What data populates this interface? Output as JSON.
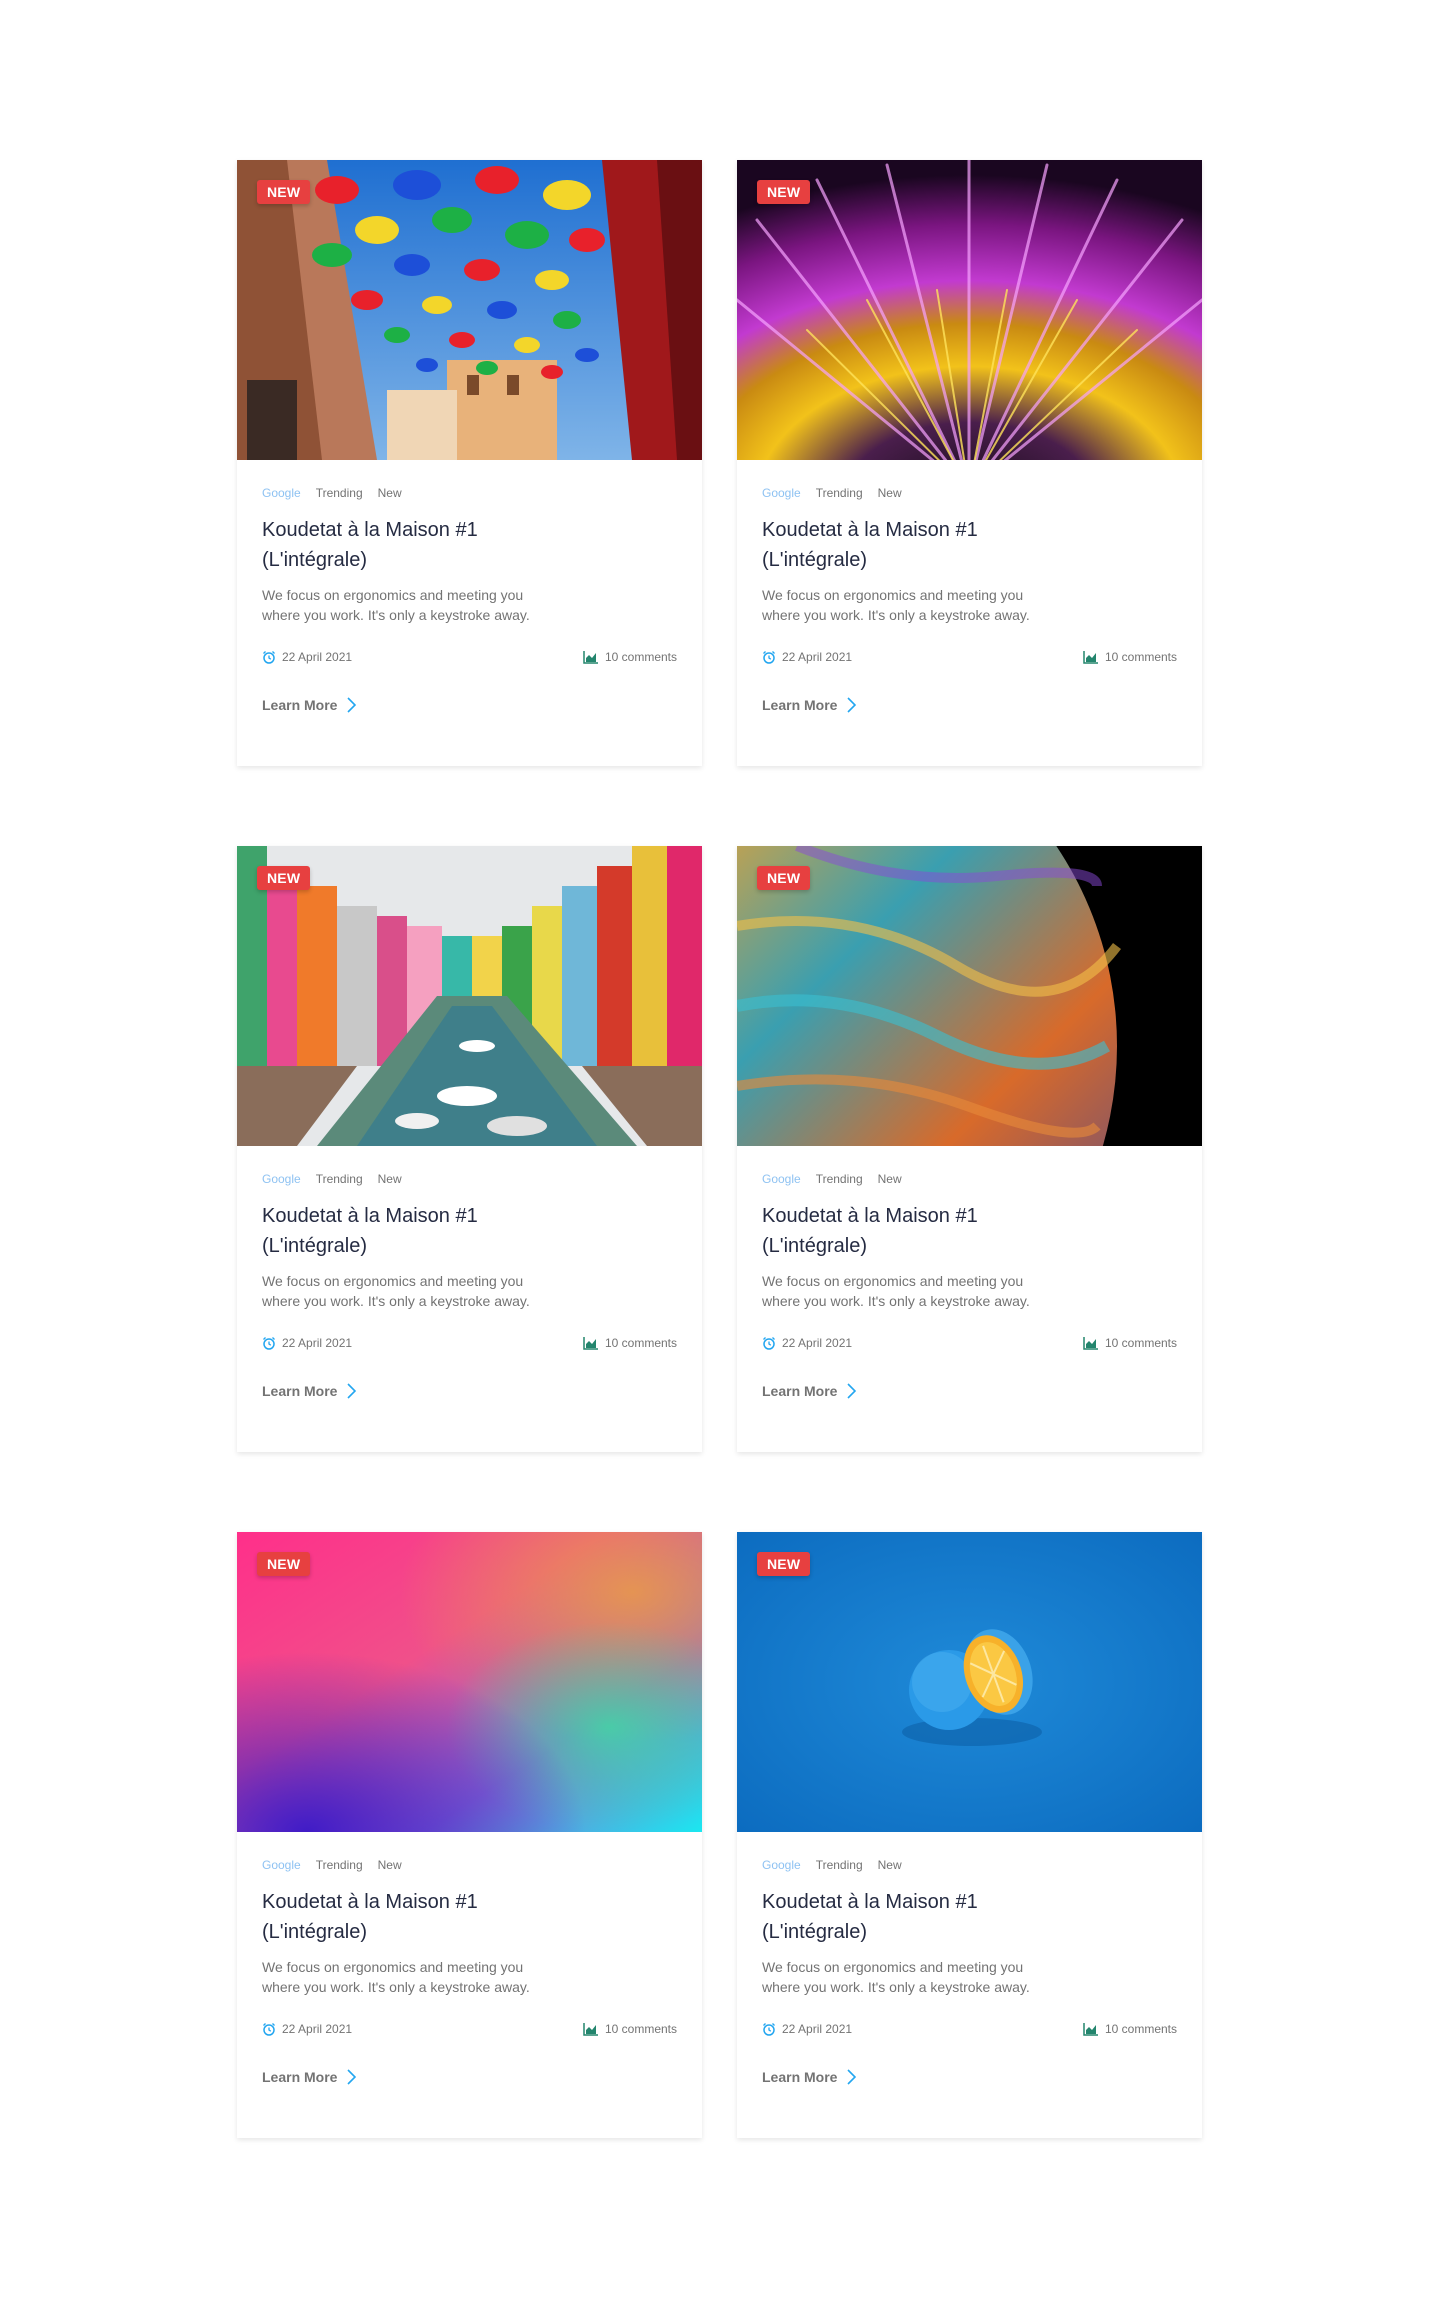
{
  "colors": {
    "badge": "#e74040",
    "tag_primary": "#8ec2f2",
    "muted": "#737373",
    "heading": "#252b42",
    "accent_blue": "#23a6f0",
    "accent_green": "#23856d"
  },
  "cards": [
    {
      "image": "colorful-umbrellas-street",
      "badge": "NEW",
      "tags": [
        "Google",
        "Trending",
        "New"
      ],
      "title": "Koudetat à la Maison #1 (L'intégrale)",
      "description": "We focus on ergonomics and meeting you where you work. It's only a keystroke away.",
      "date": "22 April 2021",
      "comments": "10 comments",
      "cta": "Learn More",
      "icons": [
        "alarm-clock-icon",
        "chart-icon",
        "chevron-right-icon"
      ]
    },
    {
      "image": "purple-gold-light-burst",
      "badge": "NEW",
      "tags": [
        "Google",
        "Trending",
        "New"
      ],
      "title": "Koudetat à la Maison #1 (L'intégrale)",
      "description": "We focus on ergonomics and meeting you where you work. It's only a keystroke away.",
      "date": "22 April 2021",
      "comments": "10 comments",
      "cta": "Learn More",
      "icons": [
        "alarm-clock-icon",
        "chart-icon",
        "chevron-right-icon"
      ]
    },
    {
      "image": "colorful-houses-canal",
      "badge": "NEW",
      "tags": [
        "Google",
        "Trending",
        "New"
      ],
      "title": "Koudetat à la Maison #1 (L'intégrale)",
      "description": "We focus on ergonomics and meeting you where you work. It's only a keystroke away.",
      "date": "22 April 2021",
      "comments": "10 comments",
      "cta": "Learn More",
      "icons": [
        "alarm-clock-icon",
        "chart-icon",
        "chevron-right-icon"
      ]
    },
    {
      "image": "soap-bubble-planet",
      "badge": "NEW",
      "tags": [
        "Google",
        "Trending",
        "New"
      ],
      "title": "Koudetat à la Maison #1 (L'intégrale)",
      "description": "We focus on ergonomics and meeting you where you work. It's only a keystroke away.",
      "date": "22 April 2021",
      "comments": "10 comments",
      "cta": "Learn More",
      "icons": [
        "alarm-clock-icon",
        "chart-icon",
        "chevron-right-icon"
      ]
    },
    {
      "image": "pink-cyan-gradient",
      "badge": "NEW",
      "tags": [
        "Google",
        "Trending",
        "New"
      ],
      "title": "Koudetat à la Maison #1 (L'intégrale)",
      "description": "We focus on ergonomics and meeting you where you work. It's only a keystroke away.",
      "date": "22 April 2021",
      "comments": "10 comments",
      "cta": "Learn More",
      "icons": [
        "alarm-clock-icon",
        "chart-icon",
        "chevron-right-icon"
      ]
    },
    {
      "image": "blue-orange-on-blue",
      "badge": "NEW",
      "tags": [
        "Google",
        "Trending",
        "New"
      ],
      "title": "Koudetat à la Maison #1 (L'intégrale)",
      "description": "We focus on ergonomics and meeting you where you work. It's only a keystroke away.",
      "date": "22 April 2021",
      "comments": "10 comments",
      "cta": "Learn More",
      "icons": [
        "alarm-clock-icon",
        "chart-icon",
        "chevron-right-icon"
      ]
    }
  ]
}
